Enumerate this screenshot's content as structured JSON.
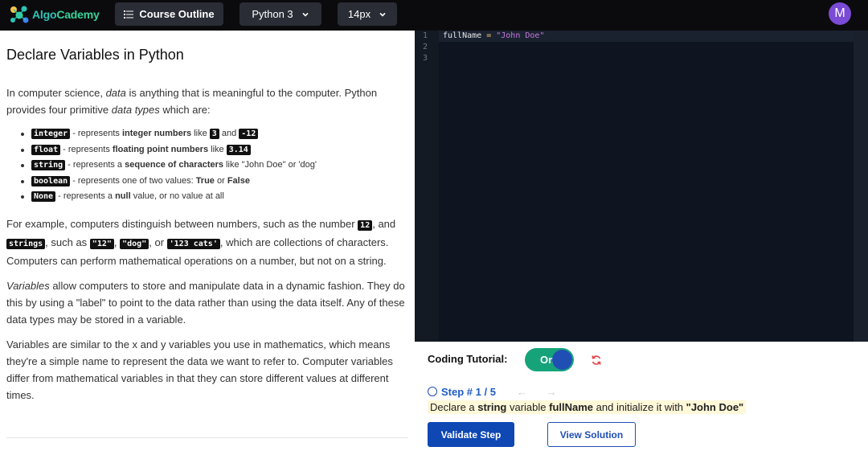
{
  "brand": {
    "name_part1": "Algo",
    "name_part2": "Cademy"
  },
  "toolbar": {
    "outline_label": "Course Outline",
    "language_label": "Python 3",
    "font_size_label": "14px"
  },
  "user": {
    "avatar_initial": "M"
  },
  "lesson": {
    "title": "Declare Variables in Python",
    "intro": {
      "a": "In computer science, ",
      "b": "data",
      "c": " is anything that is meaningful to the computer. Python provides four primitive ",
      "d": "data types",
      "e": " which are:"
    },
    "types": [
      {
        "code": "integer",
        "t1": " - represents ",
        "b1": "integer numbers",
        "t2": " like ",
        "c1": "3",
        "t3": " and ",
        "c2": "-12"
      },
      {
        "code": "float",
        "t1": " - represents ",
        "b1": "floating point numbers",
        "t2": " like ",
        "c1": "3.14"
      },
      {
        "code": "string",
        "t1": " - represents a ",
        "b1": "sequence of characters",
        "t2": " like \"John Doe\" or 'dog'"
      },
      {
        "code": "boolean",
        "t1": " - represents one of two values: ",
        "b1": "True",
        "t2": " or ",
        "b2": "False"
      },
      {
        "code": "None",
        "t1": " - represents a ",
        "b1": "null",
        "t2": " value, or no value at all"
      }
    ],
    "example": {
      "a": "For example, computers distinguish between numbers, such as the number ",
      "c1": "12",
      "b": ", and ",
      "c2": "strings",
      "c": ", such as ",
      "c3": "\"12\"",
      "d": ", ",
      "c4": "\"dog\"",
      "e": ", or ",
      "c5": "'123 cats'",
      "f": ", which are collections of characters. Computers can perform mathematical operations on a number, but not on a string."
    },
    "variables": {
      "em": "Variables",
      "rest": " allow computers to store and manipulate data in a dynamic fashion. They do this by using a \"label\" to point to the data rather than using the data itself. Any of these data types may be stored in a variable."
    },
    "math_para": "Variables are similar to the x and y variables you use in mathematics, which means they're a simple name to represent the data we want to refer to. Computer variables differ from mathematical variables in that they can store different values at different times."
  },
  "editor": {
    "line_numbers": [
      "1",
      "2",
      "3"
    ],
    "code": {
      "ident": "fullName",
      "op": " = ",
      "str": "\"John Doe\""
    }
  },
  "tutorial": {
    "label": "Coding Tutorial:",
    "toggle_label": "On",
    "step_label": "Step # 1 / 5",
    "step_arrows": "← →",
    "desc": {
      "a": "Declare a ",
      "b1": "string",
      "b": " variable ",
      "b2": "fullName",
      "c": " and initialize it with ",
      "b3": "\"John Doe\""
    },
    "validate_label": "Validate Step",
    "solution_label": "View Solution"
  },
  "colors": {
    "topbar_bg": "#0b0b0e",
    "brand_teal": "#2ec4b6",
    "toggle_on": "#16a37a",
    "primary_blue": "#0f47b3",
    "avatar_purple": "#7a4bd4",
    "editor_bg": "#0f1520"
  }
}
